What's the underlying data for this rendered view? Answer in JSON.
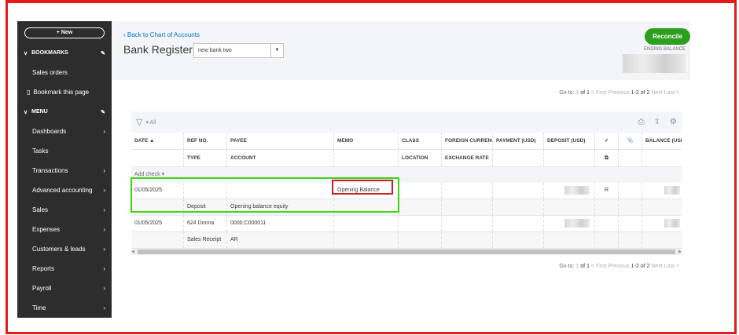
{
  "sidebar": {
    "new_label": "+ New",
    "bookmarks": "BOOKMARKS",
    "sales_orders": "Sales orders",
    "bookmark_page": "Bookmark this page",
    "menu": "MENU",
    "items": [
      {
        "label": "Dashboards"
      },
      {
        "label": "Tasks"
      },
      {
        "label": "Transactions"
      },
      {
        "label": "Advanced accounting"
      },
      {
        "label": "Sales"
      },
      {
        "label": "Expenses"
      },
      {
        "label": "Customers & leads"
      },
      {
        "label": "Reports"
      },
      {
        "label": "Payroll"
      },
      {
        "label": "Time"
      }
    ]
  },
  "header": {
    "back": "Back to Chart of Accounts",
    "title": "Bank Register",
    "account": "new bank two",
    "reconcile": "Reconcile",
    "ending_balance": "ENDING BALANCE"
  },
  "pager": {
    "goto": "Go to:",
    "page": "1",
    "of": "of 1",
    "first": "< First",
    "previous": "Previous",
    "range": "1-2 of 2",
    "next": "Next",
    "last": "Last >"
  },
  "toolbar": {
    "filter": "▾ All"
  },
  "columns": {
    "date": "DATE ▲",
    "ref": "REF NO.",
    "type": "TYPE",
    "payee": "PAYEE",
    "account": "ACCOUNT",
    "memo": "MEMO",
    "class": "CLASS",
    "location": "LOCATION",
    "fc": "FOREIGN CURRENCY",
    "rate": "EXCHANGE RATE",
    "payment": "PAYMENT (USD)",
    "deposit": "DEPOSIT (USD)",
    "check": "✓",
    "balance": "BALANCE (USD)"
  },
  "add_check": "Add check ▾",
  "rows": [
    {
      "date": "01/05/2025",
      "ref": "",
      "type": "Deposit",
      "payee": "",
      "account": "Opening balance equity",
      "memo": "Opening Balance",
      "status": "R"
    },
    {
      "date": "01/05/2025",
      "ref": "624 Donna",
      "type": "Sales Receipt",
      "payee": "0000:C000011",
      "account": "AR",
      "memo": "",
      "status": ""
    }
  ]
}
